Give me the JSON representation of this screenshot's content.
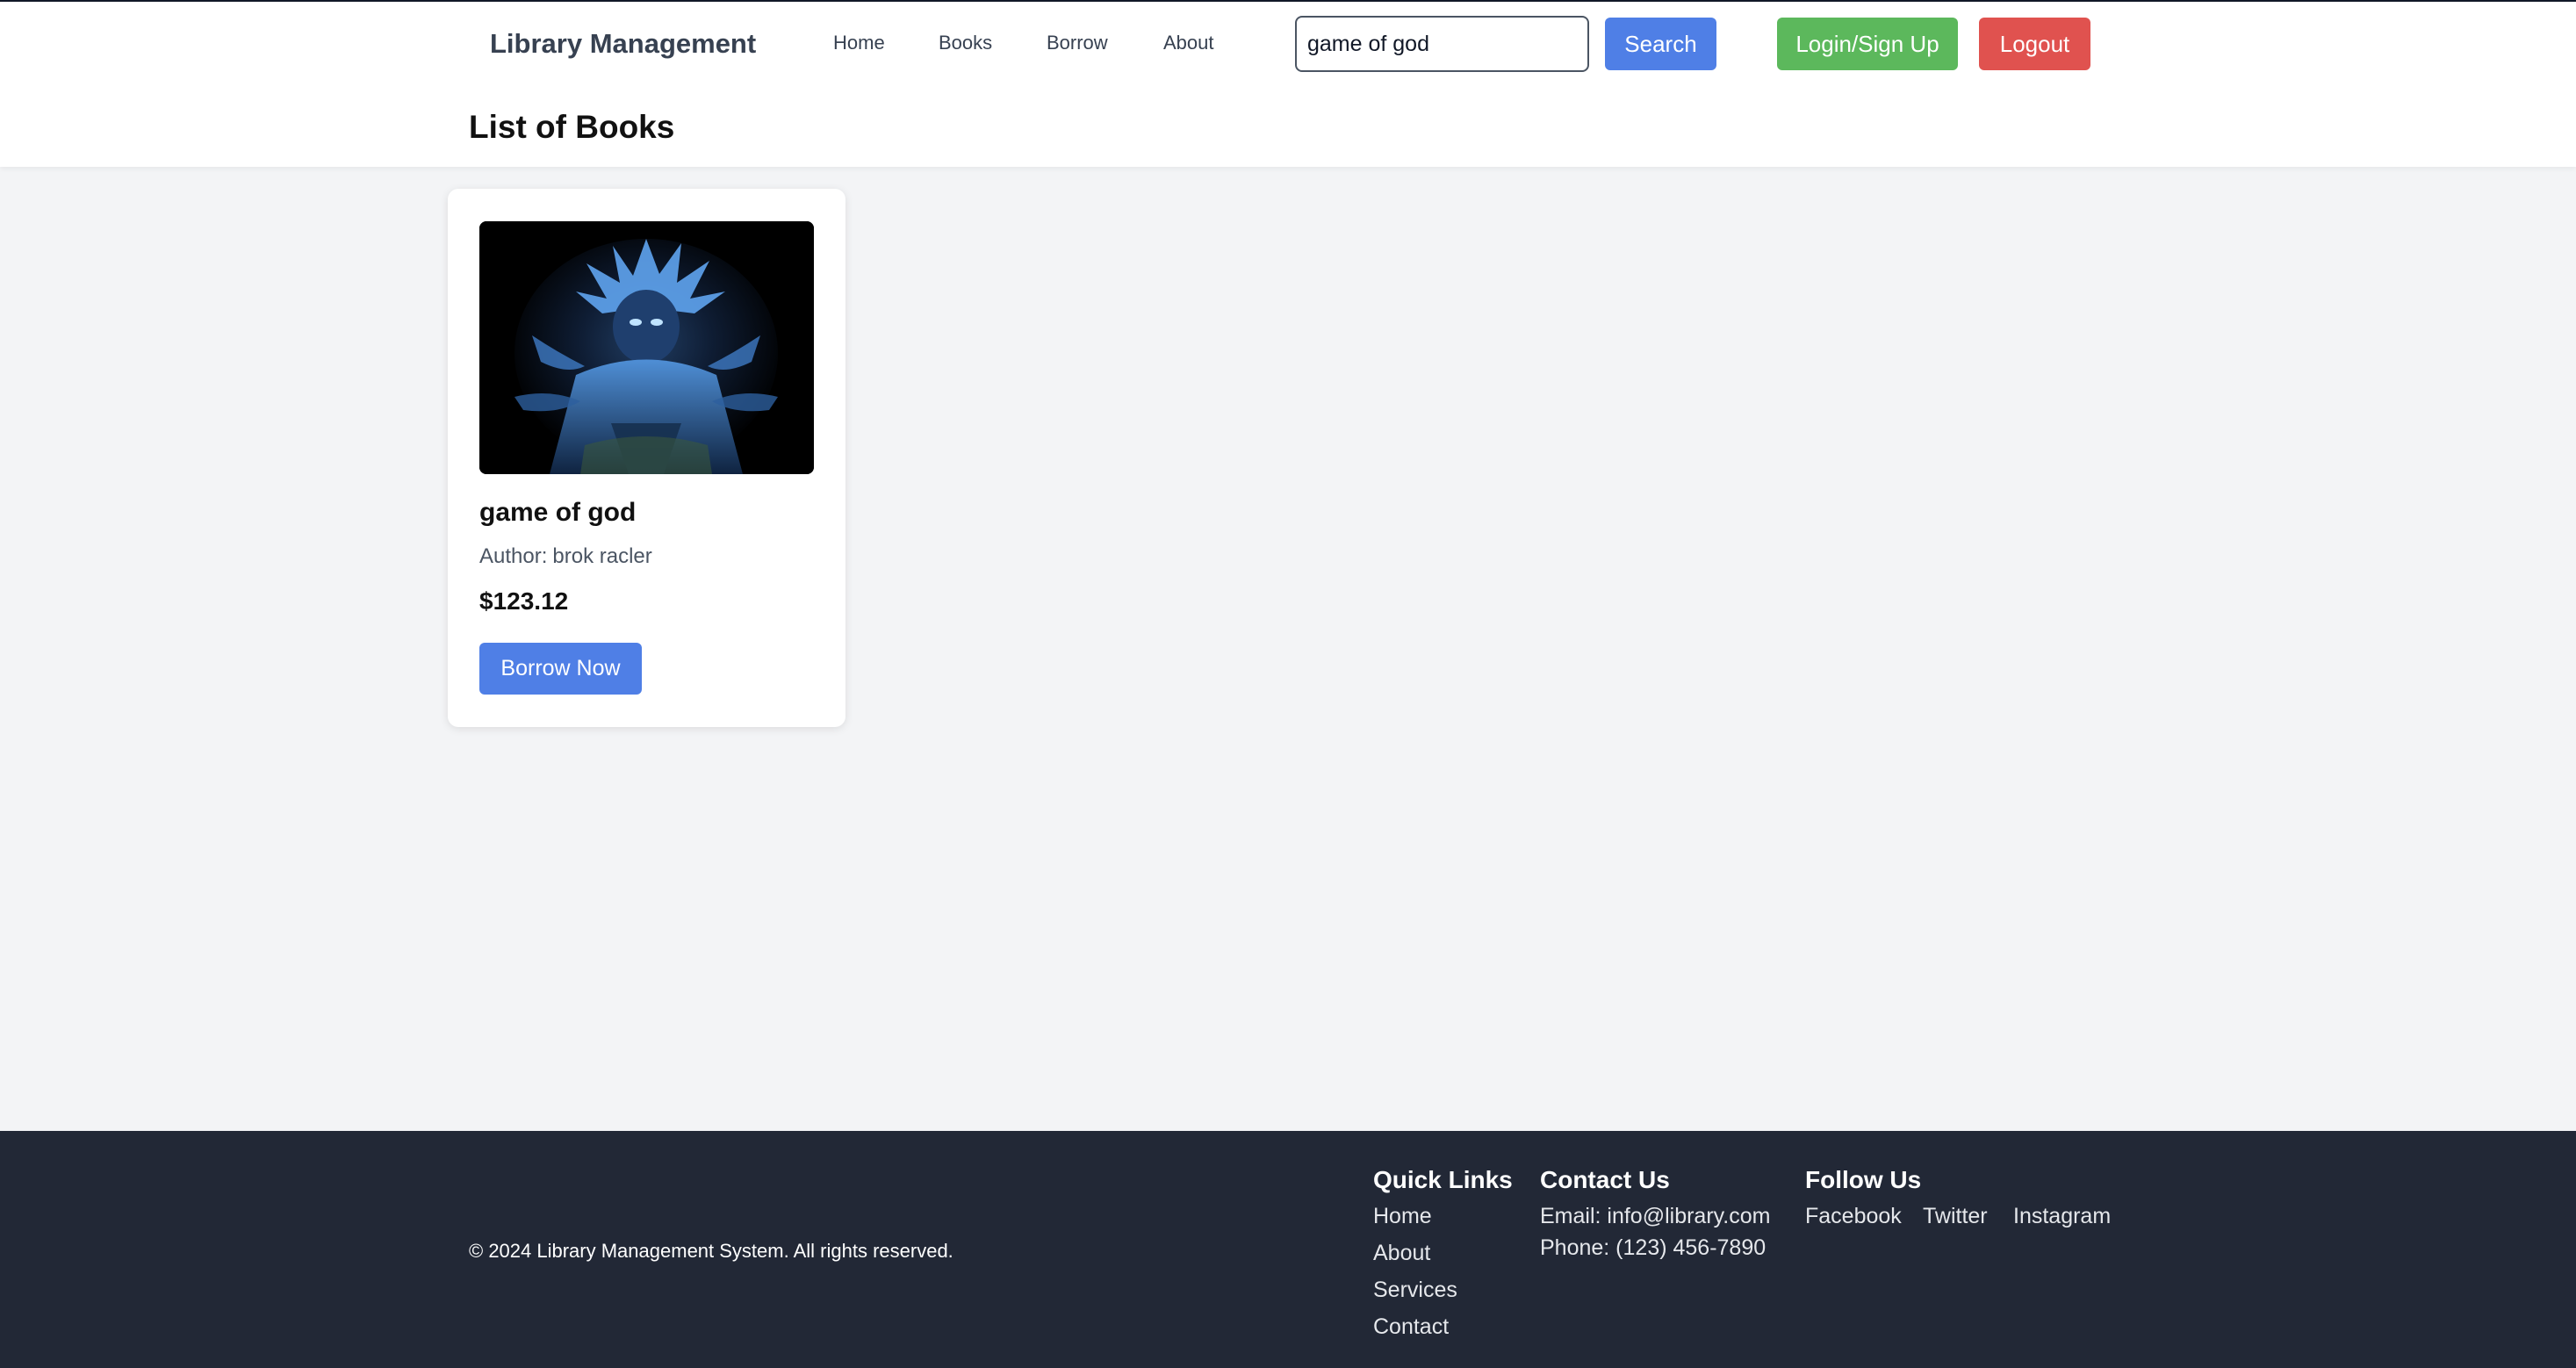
{
  "header": {
    "brand": "Library Management",
    "nav": [
      {
        "label": "Home"
      },
      {
        "label": "Books"
      },
      {
        "label": "Borrow"
      },
      {
        "label": "About"
      }
    ],
    "search": {
      "value": "game of god",
      "button_label": "Search"
    },
    "login_label": "Login/Sign Up",
    "logout_label": "Logout",
    "colors": {
      "search_button": "#4f7fe6",
      "login_button": "#5cb85c",
      "logout_button": "#e0524f"
    }
  },
  "main": {
    "title": "List of Books",
    "books": [
      {
        "title": "game of god",
        "author_prefix": "Author:",
        "author": "brok racler",
        "price": "$123.12",
        "borrow_label": "Borrow Now",
        "cover_icon": "anime-character-illustration"
      }
    ]
  },
  "footer": {
    "copyright": "© 2024 Library Management System. All rights reserved.",
    "quick_links": {
      "heading": "Quick Links",
      "items": [
        {
          "label": "Home"
        },
        {
          "label": "About"
        },
        {
          "label": "Services"
        },
        {
          "label": "Contact"
        }
      ]
    },
    "contact": {
      "heading": "Contact Us",
      "email": "Email: info@library.com",
      "phone": "Phone: (123) 456-7890"
    },
    "follow": {
      "heading": "Follow Us",
      "items": [
        {
          "label": "Facebook"
        },
        {
          "label": "Twitter"
        },
        {
          "label": "Instagram"
        }
      ]
    },
    "background": "#222836"
  }
}
